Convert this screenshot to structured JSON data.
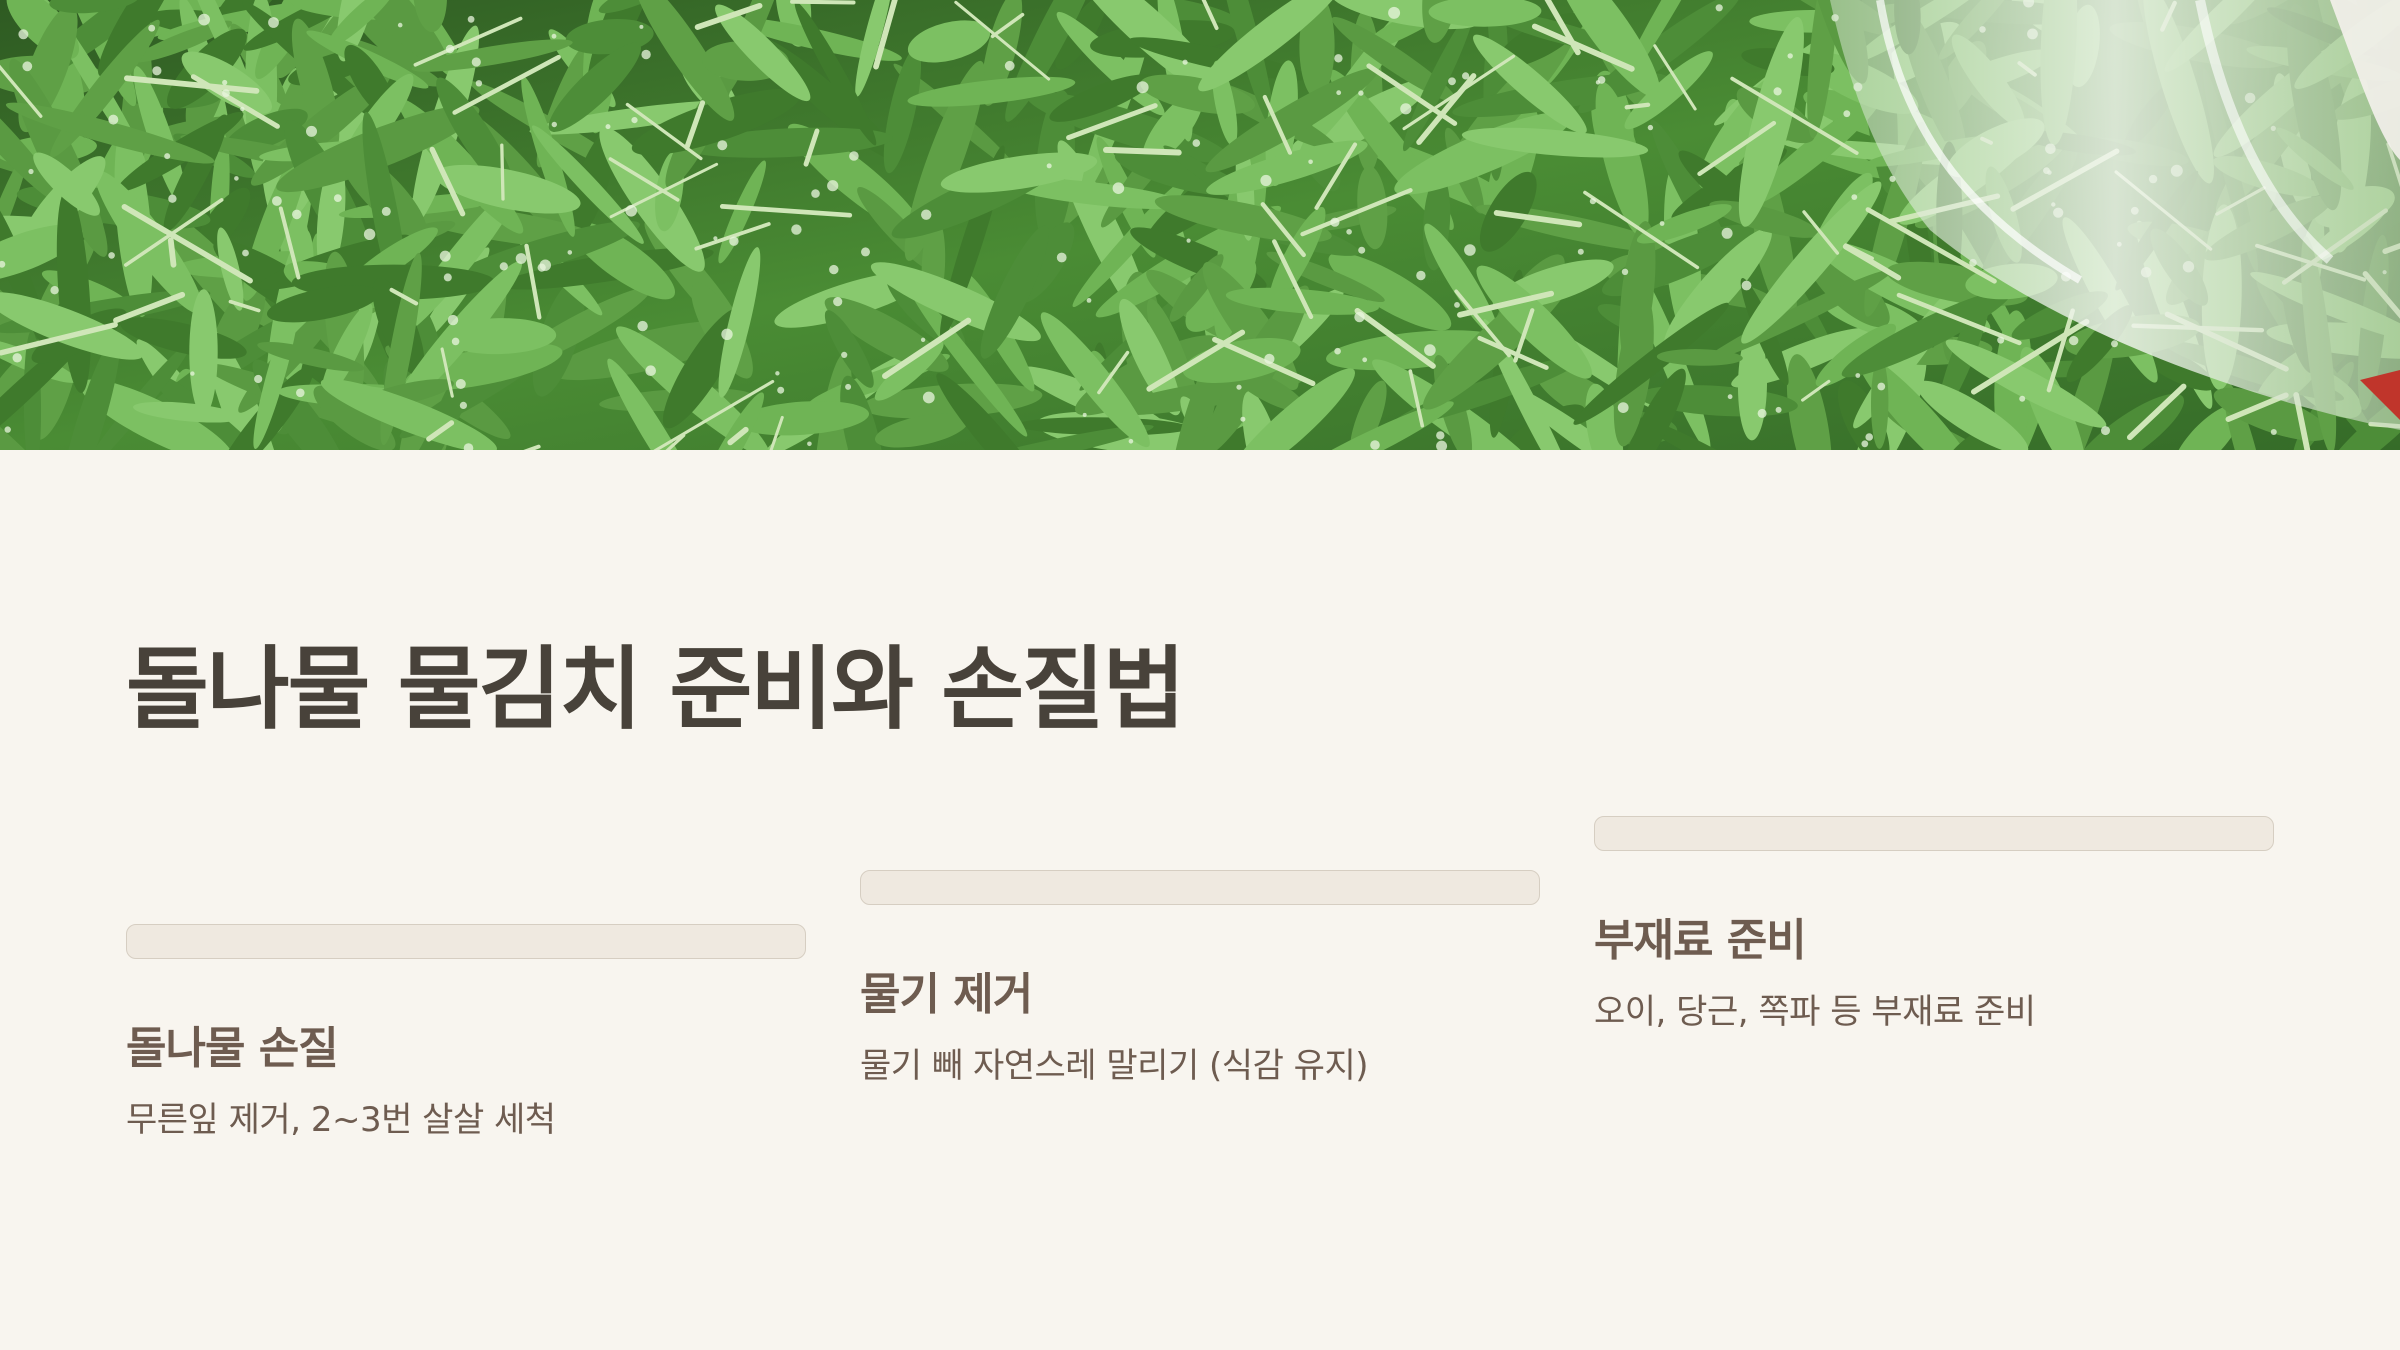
{
  "slide": {
    "title": "돌나물 물김치 준비와 손질법",
    "hero_image": "fresh stonecrop greens with water droplets and a glass bottle",
    "colors": {
      "background": "#f8f5ef",
      "title": "#48423a",
      "text": "#6e5c50",
      "bar": "#efe9e0"
    }
  },
  "cards": [
    {
      "heading": "돌나물 손질",
      "description": "무른잎 제거, 2~3번 살살 세척"
    },
    {
      "heading": "물기 제거",
      "description": "물기 빼 자연스레 말리기 (식감 유지)"
    },
    {
      "heading": "부재료 준비",
      "description": "오이, 당근, 쪽파 등 부재료 준비"
    }
  ]
}
